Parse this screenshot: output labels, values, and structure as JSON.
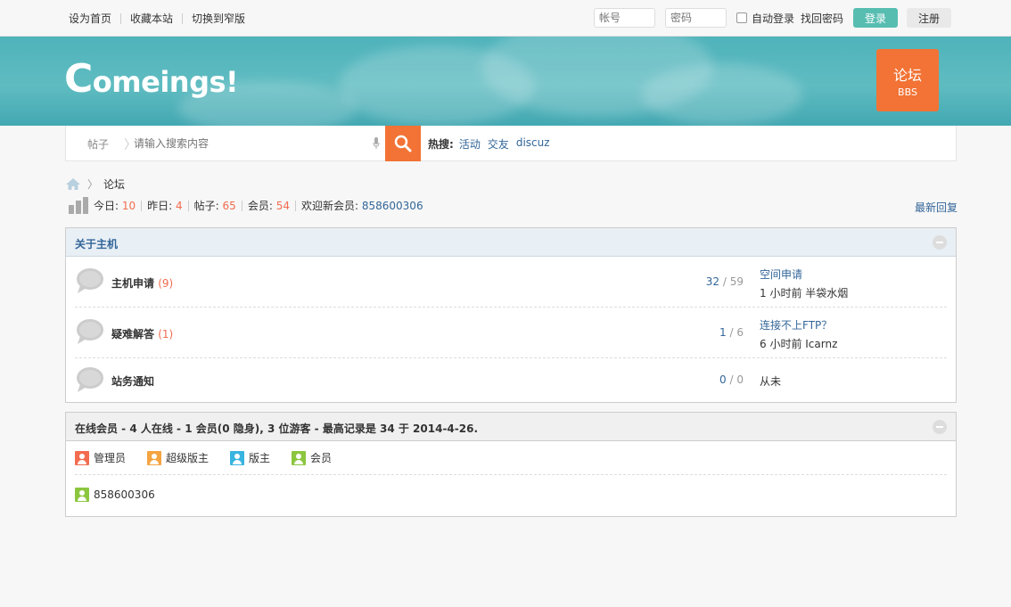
{
  "topbar": {
    "links": [
      "设为首页",
      "收藏本站",
      "切换到窄版"
    ],
    "username_placeholder": "帐号",
    "password_placeholder": "密码",
    "auto_login": "自动登录",
    "find_password": "找回密码",
    "login_button": "登录",
    "register_button": "注册"
  },
  "banner": {
    "logo_text": "omeings!",
    "logo_initial": "C",
    "bbs_title": "论坛",
    "bbs_sub": "BBS"
  },
  "search": {
    "type": "帖子",
    "placeholder": "请输入搜索内容",
    "hot_label": "热搜:",
    "hot_keywords": [
      "活动",
      "交友",
      "discuz"
    ]
  },
  "breadcrumb": {
    "current": "论坛"
  },
  "stats": {
    "today_label": "今日:",
    "today": "10",
    "yesterday_label": "昨日:",
    "yesterday": "4",
    "posts_label": "帖子:",
    "posts": "65",
    "members_label": "会员:",
    "members": "54",
    "welcome_label": "欢迎新会员:",
    "new_member": "858600306",
    "latest_reply": "最新回复"
  },
  "category": {
    "title": "关于主机",
    "forums": [
      {
        "name": "主机申请",
        "today": "(9)",
        "threads": "32",
        "posts": "59",
        "last_title": "空间申请",
        "last_meta": "1 小时前 半袋水烟"
      },
      {
        "name": "疑难解答",
        "today": "(1)",
        "threads": "1",
        "posts": "6",
        "last_title": "连接不上FTP？",
        "last_meta": "6 小时前 Icarnz"
      },
      {
        "name": "站务通知",
        "today": "",
        "threads": "0",
        "posts": "0",
        "last_title": "",
        "last_meta": "从未"
      }
    ]
  },
  "online": {
    "title": "在线会员 - 4 人在线 - 1 会员(0 隐身), 3 位游客 - 最高记录是 34 于 2014-4-26.",
    "legend": [
      {
        "label": "管理员",
        "color": "#f26c4f"
      },
      {
        "label": "超级版主",
        "color": "#f5a442"
      },
      {
        "label": "版主",
        "color": "#39b4e0"
      },
      {
        "label": "会员",
        "color": "#8cc63f"
      }
    ],
    "users": [
      {
        "name": "858600306",
        "color": "#8cc63f"
      }
    ]
  },
  "colors": {
    "accent_orange": "#f27335",
    "teal": "#57bdb1",
    "link_blue": "#336699",
    "count_red": "#f26c4f"
  }
}
